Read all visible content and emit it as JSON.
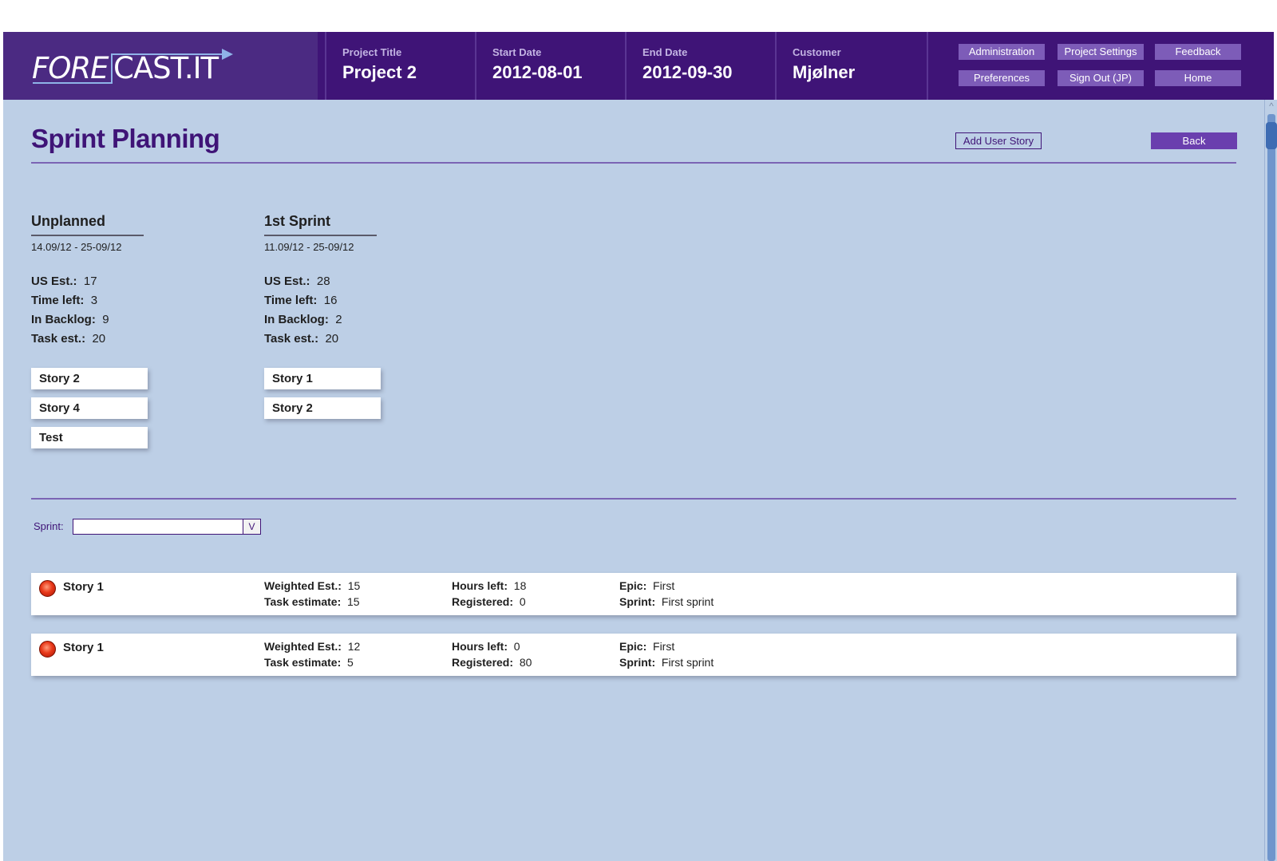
{
  "header": {
    "logo": {
      "part1": "FORE",
      "part2": "CAST.IT"
    },
    "project_title": {
      "label": "Project Title",
      "value": "Project 2"
    },
    "start_date": {
      "label": "Start Date",
      "value": "2012-08-01"
    },
    "end_date": {
      "label": "End Date",
      "value": "2012-09-30"
    },
    "customer": {
      "label": "Customer",
      "value": "Mjølner"
    },
    "nav": {
      "administration": "Administration",
      "project_settings": "Project Settings",
      "feedback": "Feedback",
      "preferences": "Preferences",
      "sign_out": "Sign Out (JP)",
      "home": "Home"
    }
  },
  "page": {
    "title": "Sprint Planning",
    "add_user_story": "Add User Story",
    "back": "Back"
  },
  "columns": [
    {
      "name": "Unplanned",
      "range": "14.09/12 - 25-09/12",
      "stats": {
        "us_est_label": "US Est.:",
        "us_est": "17",
        "time_left_label": "Time left:",
        "time_left": "3",
        "in_backlog_label": "In Backlog:",
        "in_backlog": "9",
        "task_est_label": "Task est.:",
        "task_est": "20"
      },
      "stories": [
        "Story 2",
        "Story 4",
        "Test"
      ]
    },
    {
      "name": "1st Sprint",
      "range": "11.09/12 - 25-09/12",
      "stats": {
        "us_est_label": "US Est.:",
        "us_est": "28",
        "time_left_label": "Time left:",
        "time_left": "16",
        "in_backlog_label": "In Backlog:",
        "in_backlog": "2",
        "task_est_label": "Task est.:",
        "task_est": "20"
      },
      "stories": [
        "Story 1",
        "Story 2"
      ]
    }
  ],
  "filter": {
    "sprint_label": "Sprint:",
    "sprint_value": "",
    "arrow": "V"
  },
  "rows": [
    {
      "name": "Story 1",
      "weighted_est_label": "Weighted Est.:",
      "weighted_est": "15",
      "task_estimate_label": "Task estimate:",
      "task_estimate": "15",
      "hours_left_label": "Hours left:",
      "hours_left": "18",
      "registered_label": "Registered:",
      "registered": "0",
      "epic_label": "Epic:",
      "epic": "First",
      "sprint_label": "Sprint:",
      "sprint": "First sprint",
      "status_color": "#e8391a"
    },
    {
      "name": "Story 1",
      "weighted_est_label": "Weighted Est.:",
      "weighted_est": "12",
      "task_estimate_label": "Task estimate:",
      "task_estimate": "5",
      "hours_left_label": "Hours left:",
      "hours_left": "0",
      "registered_label": "Registered:",
      "registered": "80",
      "epic_label": "Epic:",
      "epic": "First",
      "sprint_label": "Sprint:",
      "sprint": "First sprint",
      "status_color": "#e8391a"
    }
  ],
  "scrollbar": {
    "up_arrow": "^"
  },
  "colors": {
    "header_bg": "#3f1477",
    "logo_bg": "#4b2a82",
    "nav_button": "#7d5cb8",
    "main_bg": "#bdcfe6",
    "accent": "#6a3fae",
    "title": "#3f1477"
  }
}
